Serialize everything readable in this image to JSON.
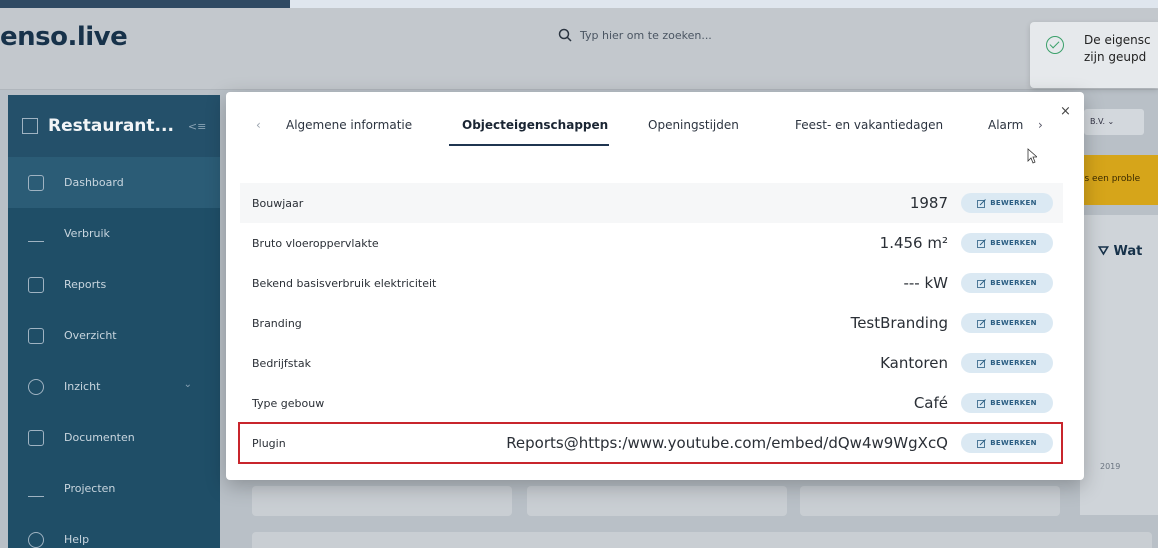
{
  "header": {
    "logo": "enso.live",
    "search_placeholder": "Typ hier om te zoeken..."
  },
  "toast": {
    "line1": "De eigensc",
    "line2": "zijn geupd"
  },
  "sidebar": {
    "title": "Restaurant...",
    "items": [
      {
        "label": "Dashboard",
        "icon": "dashboard-icon"
      },
      {
        "label": "Verbruik",
        "icon": "bar-chart-icon"
      },
      {
        "label": "Reports",
        "icon": "reports-icon"
      },
      {
        "label": "Overzicht",
        "icon": "overview-icon"
      },
      {
        "label": "Inzicht",
        "icon": "eye-icon"
      },
      {
        "label": "Documenten",
        "icon": "document-icon"
      },
      {
        "label": "Projecten",
        "icon": "project-icon"
      },
      {
        "label": "Help",
        "icon": "help-icon"
      }
    ]
  },
  "background": {
    "select_text": "B.V.",
    "alert_text": "is een proble",
    "card_title": "Wat",
    "year": "2019"
  },
  "modal": {
    "tabs": [
      {
        "label": "Algemene informatie"
      },
      {
        "label": "Objecteigenschappen"
      },
      {
        "label": "Openingstijden"
      },
      {
        "label": "Feest- en vakantiedagen"
      },
      {
        "label": "Alarm"
      }
    ],
    "active_tab": "Objecteigenschappen",
    "edit_label": "BEWERKEN",
    "rows": [
      {
        "label": "Bouwjaar",
        "value": "1987"
      },
      {
        "label": "Bruto vloeroppervlakte",
        "value": "1.456 m²"
      },
      {
        "label": "Bekend basisverbruik elektriciteit",
        "value": "--- kW"
      },
      {
        "label": "Branding",
        "value": "TestBranding"
      },
      {
        "label": "Bedrijfstak",
        "value": "Kantoren"
      },
      {
        "label": "Type gebouw",
        "value": "Café"
      },
      {
        "label": "Plugin",
        "value": "Reports@https:/www.youtube.com/embed/dQw4w9WgXcQ"
      }
    ]
  },
  "colors": {
    "sidebar": "#1f4e67",
    "highlight": "#c8252c",
    "accent": "#1f3550"
  }
}
